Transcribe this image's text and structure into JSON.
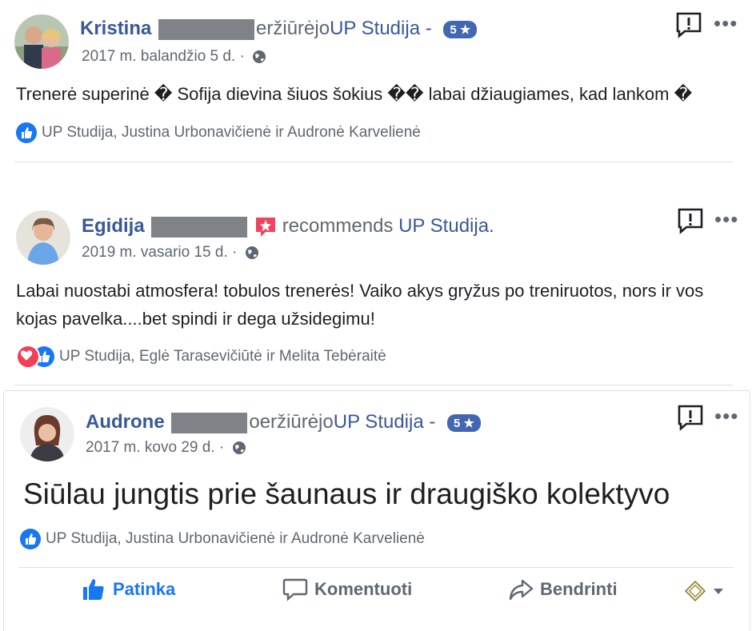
{
  "posts": [
    {
      "author": "Kristina",
      "action_suffix": "eržiūrėjo",
      "page": "UP Studija",
      "separator": " -",
      "badge": "5 ★",
      "date": "2017 m. balandžio 5 d. ·",
      "text": "Trenerė superinė � Sofija dievina šiuos šokius �� labai džiaugiames, kad lankom �",
      "reactions": "UP Studija, Justina Urbonavičienė ir Audronė Karvelienė"
    },
    {
      "author": "Egidija",
      "recommends_label": "recommends",
      "page": "UP Studija.",
      "date": "2019 m. vasario 15 d. ·",
      "text": "Labai nuostabi atmosfera! tobulos trenerės! Vaiko akys gryžus po treniruotos, nors ir vos kojas pavelka....bet spindi ir dega užsidegimu!",
      "reactions": "UP Studija, Eglė Tarasevičiūtė ir Melita Tebėraitė"
    },
    {
      "author": "Audrone",
      "action_suffix": "oeržiūrėjo",
      "page": "UP Studija",
      "separator": " -",
      "badge": "5 ★",
      "date": "2017 m. kovo 29 d. ·",
      "text": "Siūlau jungtis prie šaunaus ir draugiško kolektyvo",
      "reactions": "UP Studija, Justina Urbonavičienė ir Audronė Karvelienė"
    }
  ],
  "actions": {
    "like": "Patinka",
    "comment": "Komentuoti",
    "share": "Bendrinti"
  },
  "more_label": "•••",
  "colors": {
    "link": "#385898",
    "accent": "#1877f2",
    "badge": "#4267b2",
    "recommend": "#f3425f"
  }
}
